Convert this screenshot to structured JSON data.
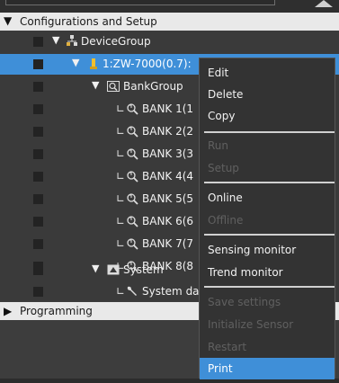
{
  "sections": {
    "configurations": "Configurations and Setup",
    "programming": "Programming"
  },
  "tree": {
    "device_group": "DeviceGroup",
    "device": "1:ZW-7000(0.7):",
    "bank_group": "BankGroup",
    "banks": [
      "BANK 1(1",
      "BANK 2(2",
      "BANK 3(3",
      "BANK 4(4",
      "BANK 5(5",
      "BANK 6(6",
      "BANK 7(7",
      "BANK 8(8"
    ],
    "system": "System",
    "system_data": "System da"
  },
  "context_menu": {
    "edit": "Edit",
    "delete": "Delete",
    "copy": "Copy",
    "run": "Run",
    "setup": "Setup",
    "online": "Online",
    "offline": "Offline",
    "sensing_monitor": "Sensing monitor",
    "trend_monitor": "Trend monitor",
    "save_settings": "Save settings",
    "initialize_sensor": "Initialize Sensor",
    "restart": "Restart",
    "print": "Print"
  },
  "colors": {
    "selection": "#3f8fd8",
    "section_bg": "#e9e9e9",
    "disabled_text": "#606060"
  }
}
